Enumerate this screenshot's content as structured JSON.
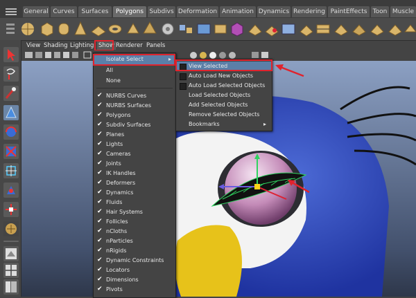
{
  "shelf_tabs": [
    "General",
    "Curves",
    "Surfaces",
    "Polygons",
    "Subdivs",
    "Deformation",
    "Animation",
    "Dynamics",
    "Rendering",
    "PaintEffects",
    "Toon",
    "Muscle"
  ],
  "active_shelf_tab": "Polygons",
  "panel_menu": [
    "View",
    "Shading",
    "Lighting",
    "Show",
    "Renderer",
    "Panels"
  ],
  "show_menu": {
    "isolate_select": "Isolate Select",
    "all": "All",
    "none": "None",
    "items": [
      "NURBS Curves",
      "NURBS Surfaces",
      "Polygons",
      "Subdiv Surfaces",
      "Planes",
      "Lights",
      "Cameras",
      "Joints",
      "IK Handles",
      "Deformers",
      "Dynamics",
      "Fluids",
      "Hair Systems",
      "Follicles",
      "nCloths",
      "nParticles",
      "nRigids",
      "Dynamic Constraints",
      "Locators",
      "Dimensions",
      "Pivots"
    ]
  },
  "isolate_submenu": {
    "items": [
      "View Selected",
      "Auto Load New Objects",
      "Auto Load Selected Objects",
      "Load Selected Objects",
      "Add Selected Objects",
      "Remove Selected Objects",
      "Bookmarks"
    ]
  },
  "colors": {
    "highlight": "#5b7fa8",
    "annotation_red": "#e0232d",
    "shelf_bg": "#4b4b4b",
    "panel_bg": "#444444"
  }
}
